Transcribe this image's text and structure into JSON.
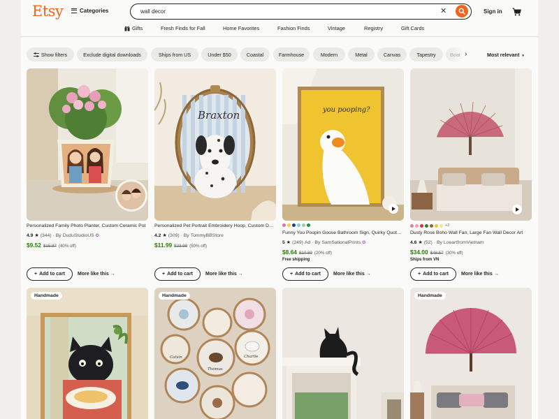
{
  "header": {
    "logo": "Etsy",
    "categories_label": "Categories",
    "search_value": "wall decor",
    "signin_label": "Sign in"
  },
  "subnav": [
    "Gifts",
    "Fresh Finds for Fall",
    "Home Favorites",
    "Fashion Finds",
    "Vintage",
    "Registry",
    "Gift Cards"
  ],
  "filters": {
    "chips": [
      "Show filters",
      "Exclude digital downloads",
      "Ships from US",
      "Under $50",
      "Coastal",
      "Farmhouse",
      "Modern",
      "Metal",
      "Canvas",
      "Tapestry",
      "Boat"
    ],
    "sort_label": "Most relevant"
  },
  "products": [
    {
      "title": "Personalized Family Photo Planter, Custom Ceramic Pot",
      "rating": "4.9",
      "reviews": "(344)",
      "seller": "DuduStudioUS",
      "star_seller": true,
      "ad": "",
      "price": "$9.52",
      "old_price": "$15.87",
      "discount": "(40% off)",
      "shipping": "",
      "swatches": [],
      "swatch_more": "",
      "video": false,
      "tag": "",
      "add_label": "Add to cart",
      "more_label": "More like this"
    },
    {
      "title": "Personalized Pet Portrait Embroidery Hoop, Custom Dog Art",
      "rating": "4.2",
      "reviews": "(309)",
      "seller": "TommyBBStore",
      "star_seller": false,
      "ad": "",
      "price": "$11.99",
      "old_price": "$23.98",
      "discount": "(50% off)",
      "shipping": "",
      "swatches": [],
      "swatch_more": "",
      "video": false,
      "tag": "",
      "add_label": "Add to cart",
      "more_label": "More like this"
    },
    {
      "title": "Funny You Poopin Goose Bathroom Sign, Quirky Quote Print",
      "rating": "5",
      "reviews": "(249)",
      "seller": "SamSationalPrints",
      "star_seller": true,
      "ad": "Ad",
      "price": "$8.64",
      "old_price": "$10.80",
      "discount": "(20% off)",
      "shipping": "Free shipping",
      "swatches": [
        "#e86fa0",
        "#f0d23c",
        "#1f3d8c",
        "#7ec8e8",
        "#9ad0a0",
        "#2b8a3e"
      ],
      "swatch_more": "",
      "video": true,
      "tag": "",
      "add_label": "Add to cart",
      "more_label": "More like this"
    },
    {
      "title": "Dusty Rose Boho Wall Fan, Large Fan Wall Decor Art",
      "rating": "4.6",
      "reviews": "(52)",
      "seller": "LoeartfromVietnam",
      "star_seller": false,
      "ad": "",
      "price": "$34.00",
      "old_price": "$48.57",
      "discount": "(30% off)",
      "shipping": "Ships from VN",
      "swatches": [
        "#e07ea0",
        "#e8a0b4",
        "#d9332e",
        "#2e7d32",
        "#8a6a2c",
        "#e8c83a",
        "#f2e880"
      ],
      "swatch_more": "+2",
      "video": true,
      "tag": "",
      "add_label": "Add to cart",
      "more_label": "More like this"
    },
    {
      "tag": "Handmade"
    },
    {
      "tag": "Handmade"
    },
    {
      "tag": ""
    },
    {
      "tag": "Handmade"
    }
  ],
  "image_text": {
    "embroidery_name": "Braxton",
    "goose_caption": "you pooping?",
    "hoop_names": [
      "Calvin",
      "Thomas",
      "Charlie"
    ]
  },
  "colors": {
    "brand": "#f1641e",
    "price": "#268000",
    "star_seller_badge": "#9d4ec8"
  }
}
